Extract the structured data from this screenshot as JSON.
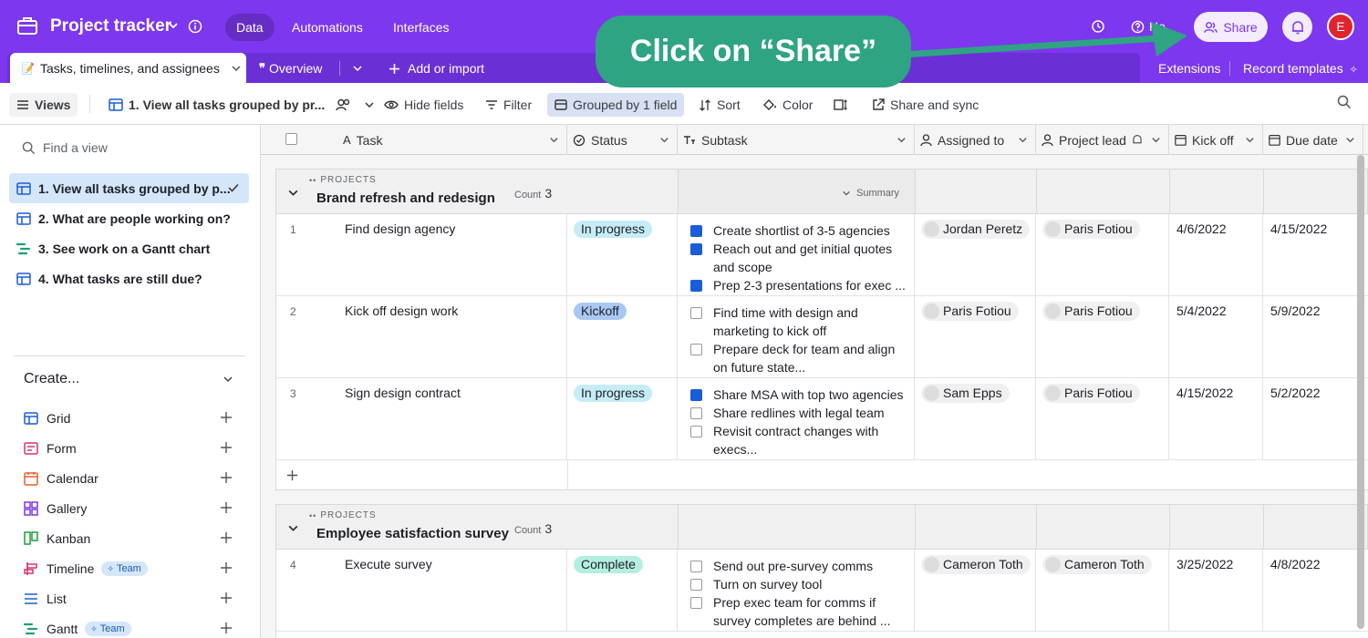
{
  "topbar": {
    "app_title": "Project tracker",
    "nav": [
      "Data",
      "Automations",
      "Interfaces"
    ],
    "help_label": "He",
    "share_label": "Share",
    "avatar_initial": "E"
  },
  "tabbar": {
    "table_tab": "Tasks, timelines, and assignees",
    "overview": "Overview",
    "add_import": "Add or import",
    "extensions": "Extensions",
    "record_templates": "Record templates"
  },
  "toolbar": {
    "views": "Views",
    "current_view": "1. View all tasks grouped by pr...",
    "hide_fields": "Hide fields",
    "filter": "Filter",
    "grouped": "Grouped by 1 field",
    "sort": "Sort",
    "color": "Color",
    "share_sync": "Share and sync"
  },
  "sidebar": {
    "find_placeholder": "Find a view",
    "views": [
      "1. View all tasks grouped by p...",
      "2. What are people working on?",
      "3. See work on a Gantt chart",
      "4. What tasks are still due?"
    ],
    "create_title": "Create...",
    "create_items": [
      "Grid",
      "Form",
      "Calendar",
      "Gallery",
      "Kanban",
      "Timeline",
      "List",
      "Gantt"
    ],
    "team_badge": "Team"
  },
  "columns": [
    "Task",
    "Status",
    "Subtask",
    "Assigned to",
    "Project lead",
    "Kick off",
    "Due date"
  ],
  "groups": [
    {
      "label": "PROJECTS",
      "name": "Brand refresh and redesign",
      "count_label": "Count",
      "count": "3",
      "summary": "Summary"
    },
    {
      "label": "PROJECTS",
      "name": "Employee satisfaction survey",
      "count_label": "Count",
      "count": "3"
    }
  ],
  "rows": [
    {
      "num": "1",
      "task": "Find design agency",
      "status": "In progress",
      "sub": [
        "Create shortlist of 3-5 agencies",
        "Reach out and get initial quotes",
        "and scope",
        "Prep 2-3 presentations for exec ..."
      ],
      "assigned": "Jordan Peretz",
      "lead": "Paris Fotiou",
      "kickoff": "4/6/2022",
      "due": "4/15/2022"
    },
    {
      "num": "2",
      "task": "Kick off design work",
      "status": "Kickoff",
      "sub": [
        "Find time with design and",
        "marketing to kick off",
        "Prepare deck for team and align",
        "on future state..."
      ],
      "assigned": "Paris Fotiou",
      "lead": "Paris Fotiou",
      "kickoff": "5/4/2022",
      "due": "5/9/2022"
    },
    {
      "num": "3",
      "task": "Sign design contract",
      "status": "In progress",
      "sub": [
        "Share MSA with top two agencies",
        "Share redlines with legal team",
        "Revisit contract changes with",
        "execs..."
      ],
      "assigned": "Sam Epps",
      "lead": "Paris Fotiou",
      "kickoff": "4/15/2022",
      "due": "5/2/2022"
    },
    {
      "num": "4",
      "task": "Execute survey",
      "status": "Complete",
      "sub": [
        "Send out pre-survey comms",
        "Turn on survey tool",
        "Prep exec team for comms if",
        "survey completes are behind ..."
      ],
      "assigned": "Cameron Toth",
      "lead": "Cameron Toth",
      "kickoff": "3/25/2022",
      "due": "4/8/2022"
    }
  ],
  "callout": "Click on “Share”",
  "colors": {
    "brand": "#7c37ef",
    "callout": "#2fa482",
    "in_progress": "#c6ecf7",
    "kickoff": "#a9c8f2",
    "complete": "#b3efde"
  }
}
